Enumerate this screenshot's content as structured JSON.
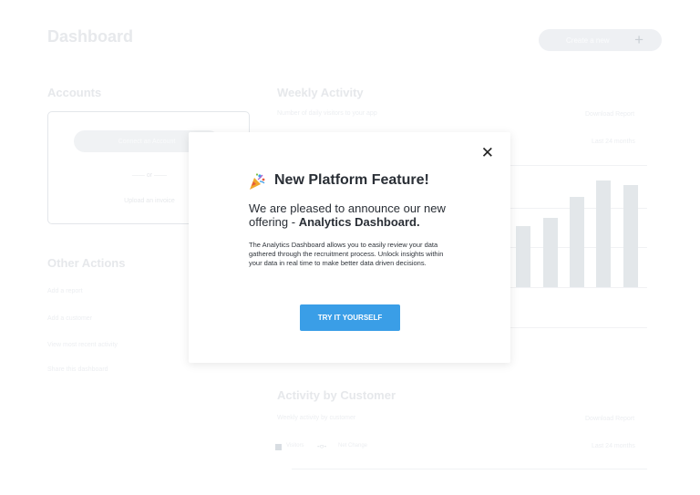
{
  "header": {
    "title": "Dashboard",
    "create_label": "Create a new",
    "create_icon": "plus-icon"
  },
  "accounts": {
    "heading": "Accounts",
    "connect_label": "Connect an Account",
    "or_label": "or",
    "upload_label": "Upload an invoice"
  },
  "other_actions": {
    "heading": "Other Actions",
    "items": [
      {
        "label": "Add a report"
      },
      {
        "label": "Add a customer"
      },
      {
        "label": "View most recent activity"
      },
      {
        "label": "Share this dashboard"
      }
    ]
  },
  "weekly": {
    "heading": "Weekly Activity",
    "subheading": "Number of daily visitors to your app",
    "download_label": "Download Report",
    "range_label": "Last 24 months"
  },
  "activity_customer": {
    "heading": "Activity by Customer",
    "subheading": "Weekly activity by customer",
    "download_label": "Download Report",
    "range_label": "Last 24 months",
    "legend": [
      {
        "label": "Visitors"
      },
      {
        "label": "Net Change"
      }
    ]
  },
  "modal": {
    "icon": "party-popper-icon",
    "title": "New Platform Feature!",
    "announce_prefix": "We are pleased to announce our new offering - ",
    "announce_bold": "Analytics Dashboard.",
    "description": "The Analytics Dashboard allows you to easily review your data gathered through the recruitment process. Unlock insights within your data in real time to make better data driven decisions.",
    "cta_label": "TRY IT YOURSELF",
    "close_icon": "close-icon"
  }
}
